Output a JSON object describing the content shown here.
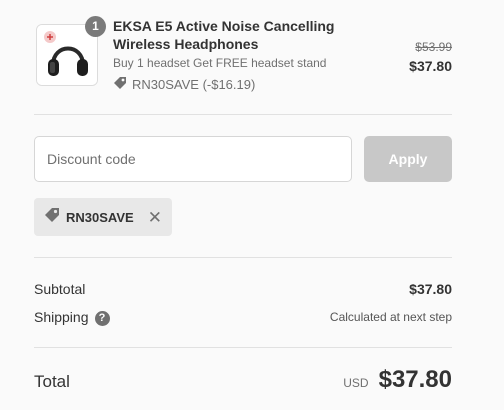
{
  "line_item": {
    "quantity": "1",
    "title": "EKSA E5 Active Noise Cancelling Wireless Headphones",
    "subtitle": "Buy 1 headset Get FREE headset stand",
    "discount_text": "RN30SAVE (-$16.19)",
    "compare_price": "$53.99",
    "price": "$37.80"
  },
  "discount_form": {
    "placeholder": "Discount code",
    "apply_label": "Apply"
  },
  "applied_discount": {
    "code": "RN30SAVE"
  },
  "summary": {
    "subtotal_label": "Subtotal",
    "subtotal_value": "$37.80",
    "shipping_label": "Shipping",
    "shipping_value": "Calculated at next step",
    "total_label": "Total",
    "currency": "USD",
    "total_value": "$37.80"
  },
  "icons": {
    "tag": "tag-icon",
    "remove": "close-icon",
    "help": "question-circle-icon"
  },
  "colors": {
    "apply_disabled": "#c8c8c8",
    "tag_bg": "#e8e8e8",
    "badge": "#7a7a7a"
  }
}
